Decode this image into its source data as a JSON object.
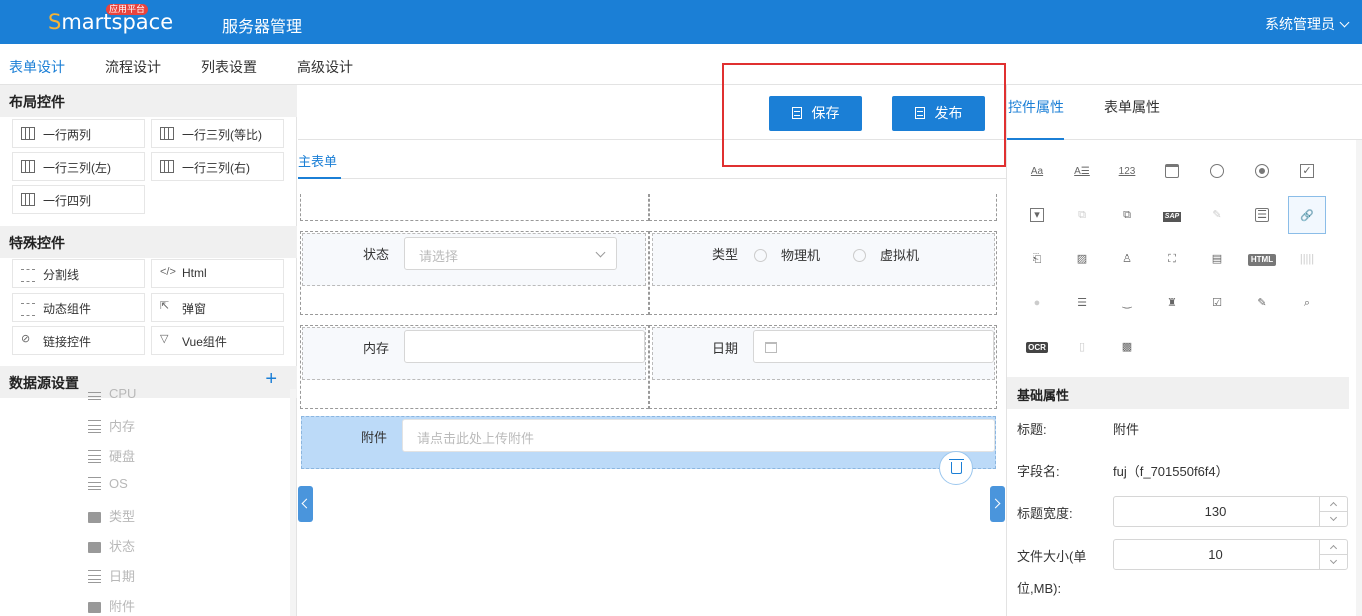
{
  "header": {
    "logo_s": "S",
    "logo_rest": "martspace",
    "logo_badge": "应用平台",
    "app_title": "服务器管理",
    "user": "系统管理员"
  },
  "tabs": [
    "表单设计",
    "流程设计",
    "列表设置",
    "高级设计"
  ],
  "left": {
    "layout_title": "布局控件",
    "layout_items": [
      "一行两列",
      "一行三列(等比)",
      "一行三列(左)",
      "一行三列(右)",
      "一行四列"
    ],
    "special_title": "特殊控件",
    "special_items": [
      "分割线",
      "Html",
      "动态组件",
      "弹窗",
      "链接控件",
      "Vue组件"
    ],
    "datasource_title": "数据源设置",
    "tree": [
      {
        "label": "CPU",
        "type": "list"
      },
      {
        "label": "内存",
        "type": "list"
      },
      {
        "label": "硬盘",
        "type": "list"
      },
      {
        "label": "OS",
        "type": "list"
      },
      {
        "label": "类型",
        "type": "folder"
      },
      {
        "label": "状态",
        "type": "folder"
      },
      {
        "label": "日期",
        "type": "list"
      },
      {
        "label": "附件",
        "type": "folder"
      }
    ]
  },
  "center": {
    "save_label": "保存",
    "publish_label": "发布",
    "subtab": "主表单",
    "status_label": "状态",
    "status_placeholder": "请选择",
    "type_label": "类型",
    "type_options": [
      "物理机",
      "虚拟机"
    ],
    "memory_label": "内存",
    "date_label": "日期",
    "attach_label": "附件",
    "attach_placeholder": "请点击此处上传附件"
  },
  "right": {
    "tabs": [
      "控件属性",
      "表单属性"
    ],
    "palette_text": {
      "aa": "Aa",
      "abc": "A☰",
      "num": "123",
      "html": "HTML",
      "sap": "SAP",
      "ocr": "OCR"
    },
    "basic_title": "基础属性",
    "props": {
      "title_label": "标题:",
      "title_value": "附件",
      "field_label": "字段名:",
      "field_value": "fuj（f_701550f6f4）",
      "width_label": "标题宽度:",
      "width_value": "130",
      "size_label_1": "文件大小(单",
      "size_label_2": "位,MB):",
      "size_value": "10"
    }
  },
  "colors": {
    "primary": "#1b7fd6",
    "highlight": "#bcdaf8",
    "annotation": "#e03030"
  }
}
